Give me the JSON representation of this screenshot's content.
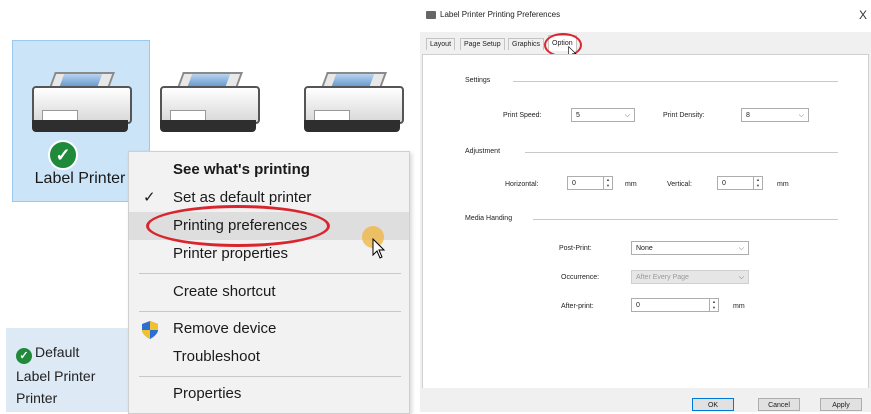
{
  "explorer": {
    "printers": [
      {
        "label": "Label Printer",
        "selected": true,
        "default": true
      },
      {
        "label": "",
        "selected": false
      },
      {
        "label": "",
        "selected": false
      }
    ],
    "status": {
      "line1": "Default",
      "line2": "Label Printer",
      "line3": "Printer"
    }
  },
  "context_menu": {
    "items": [
      {
        "label": "See what's printing",
        "bold": true
      },
      {
        "label": "Set as default printer",
        "checked": true
      },
      {
        "label": "Printing preferences",
        "highlighted": true
      },
      {
        "label": "Printer properties"
      },
      {
        "label": "Create shortcut"
      },
      {
        "label": "Remove device",
        "icon": "shield-icon"
      },
      {
        "label": "Troubleshoot"
      },
      {
        "label": "Properties"
      }
    ]
  },
  "dialog": {
    "title": "Label Printer Printing Preferences",
    "close": "X",
    "tabs": [
      "Layout",
      "Page Setup",
      "Graphics",
      "Option"
    ],
    "active_tab": "Option",
    "settings": {
      "group": "Settings",
      "print_speed_label": "Print Speed:",
      "print_speed_value": "5",
      "print_density_label": "Print Density:",
      "print_density_value": "8"
    },
    "adjustment": {
      "group": "Adjustment",
      "horizontal_label": "Horizontal:",
      "horizontal_value": "0",
      "horizontal_unit": "mm",
      "vertical_label": "Vertical:",
      "vertical_value": "0",
      "vertical_unit": "mm"
    },
    "media": {
      "group": "Media Handing",
      "post_print_label": "Post-Print:",
      "post_print_value": "None",
      "occurrence_label": "Occurrence:",
      "occurrence_value": "After Every Page",
      "after_print_label": "After-print:",
      "after_print_value": "0",
      "after_print_unit": "mm"
    },
    "buttons": {
      "ok": "OK",
      "cancel": "Cancel",
      "apply": "Apply"
    }
  },
  "colors": {
    "highlight_ring": "#d9262e",
    "selection": "#cce4f7",
    "accent": "#0078d7"
  }
}
